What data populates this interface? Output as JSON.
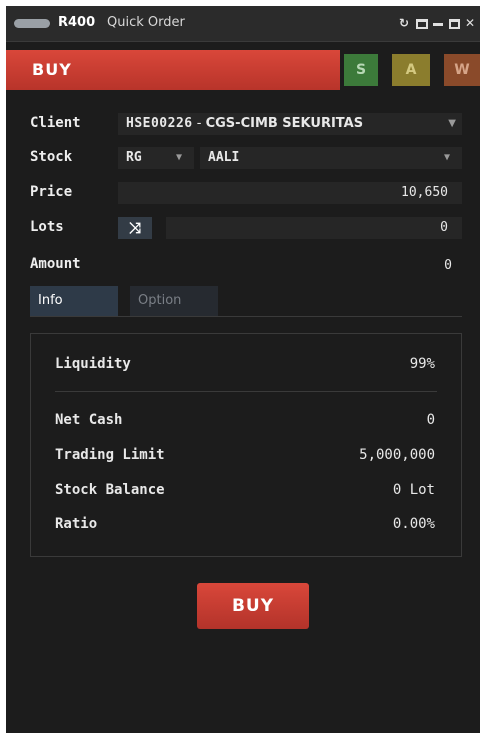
{
  "window": {
    "app": "R400",
    "title": "Quick Order",
    "controls": [
      "refresh-icon",
      "popout-icon",
      "minimize-icon",
      "maximize-icon",
      "close-icon"
    ]
  },
  "sides": {
    "buy": "BUY",
    "sell": "S",
    "amend": "A",
    "withdraw": "W"
  },
  "form": {
    "client_label": "Client",
    "client_code": "HSE00226",
    "client_separator": " - ",
    "client_name": "CGS-CIMB SEKURITAS",
    "stock_label": "Stock",
    "board": "RG",
    "stock": "AALI",
    "price_label": "Price",
    "price": "10,650",
    "lots_label": "Lots",
    "lots": "0",
    "amount_label": "Amount",
    "amount": "0"
  },
  "tabs": [
    {
      "label": "Info",
      "active": true
    },
    {
      "label": "Option",
      "active": false
    }
  ],
  "info": {
    "liquidity_label": "Liquidity",
    "liquidity": "99%",
    "net_cash_label": "Net Cash",
    "net_cash": "0",
    "trading_limit_label": "Trading Limit",
    "trading_limit": "5,000,000",
    "stock_balance_label": "Stock Balance",
    "stock_balance": "0 Lot",
    "ratio_label": "Ratio",
    "ratio": "0.00%"
  },
  "submit_label": "BUY",
  "colors": {
    "background": "#1c1c1c",
    "buy": "#c83c31",
    "sell": "#3c7a3a",
    "amend": "#8b7d2d",
    "withdraw": "#8a4a2a"
  }
}
